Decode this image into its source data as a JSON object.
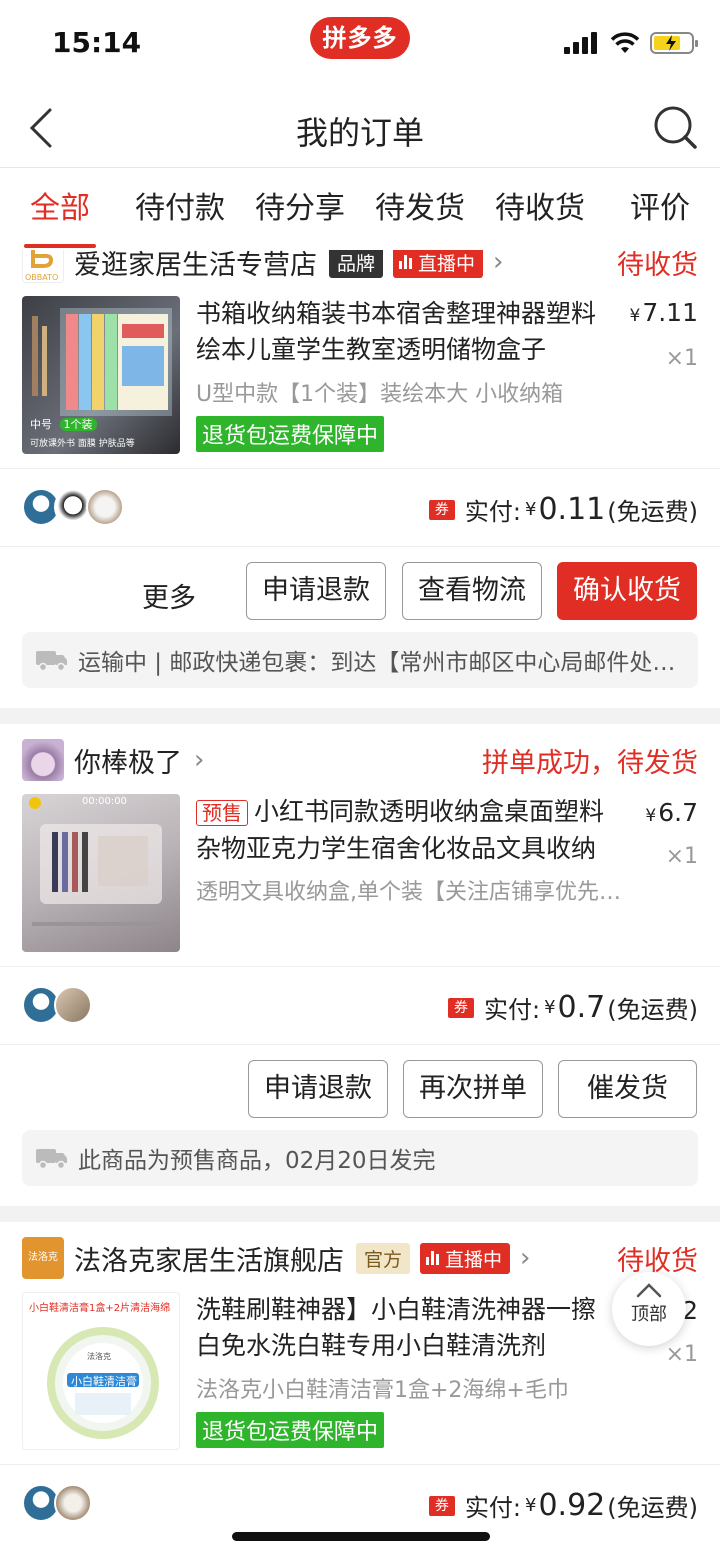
{
  "status_bar": {
    "time": "15:14",
    "app_logo": "拼多多"
  },
  "nav": {
    "title": "我的订单"
  },
  "tabs": [
    {
      "label": "全部",
      "active": true
    },
    {
      "label": "待付款"
    },
    {
      "label": "待分享"
    },
    {
      "label": "待发货"
    },
    {
      "label": "待收货"
    },
    {
      "label": "评价"
    }
  ],
  "orders": [
    {
      "shop_name": "爱逛家居生活专营店",
      "brand_badge": "品牌",
      "live_badge": "直播中",
      "status": "待收货",
      "title": "书箱收纳箱装书本宿舍整理神器塑料绘本儿童学生教室透明储物盒子",
      "price_symbol": "¥",
      "price": "7.11",
      "qty": "×1",
      "spec": "U型中款【1个装】装绘本大 小收纳箱",
      "guarantee": "退货包运费保障中",
      "thumb_label_left": "中号",
      "thumb_label_right": "1个装",
      "thumb_caption": "可放课外书 面膜 护肤品等",
      "coupon": "券",
      "paid_label": "实付:",
      "paid_symbol": "¥",
      "paid_amount": "0.11",
      "shipping_note": "(免运费)",
      "buttons": {
        "more": "更多",
        "refund": "申请退款",
        "logistics": "查看物流",
        "confirm": "确认收货"
      },
      "tracking": "运输中 | 邮政快递包裹：到达【常州市邮区中心局邮件处理中心】"
    },
    {
      "shop_name": "你棒极了",
      "status": "拼单成功，待发货",
      "presale_tag": "预售",
      "title": "小红书同款透明收纳盒桌面塑料杂物亚克力学生宿舍化妆品文具收纳",
      "price_symbol": "¥",
      "price": "6.7",
      "qty": "×1",
      "spec": "透明文具收纳盒,单个装【关注店铺享优先发货】",
      "video_time": "00:00:00",
      "coupon": "券",
      "paid_label": "实付:",
      "paid_symbol": "¥",
      "paid_amount": "0.7",
      "shipping_note": "(免运费)",
      "buttons": {
        "refund": "申请退款",
        "regroup": "再次拼单",
        "urge": "催发货"
      },
      "tracking": "此商品为预售商品，02月20日发完"
    },
    {
      "shop_name": "法洛克家居生活旗舰店",
      "shop_logo_text": "法洛克",
      "official_badge": "官方",
      "live_badge": "直播中",
      "status": "待收货",
      "title": "洗鞋刷鞋神器】小白鞋清洗神器一擦白免水洗白鞋专用小白鞋清洗剂",
      "price_tail": "2",
      "qty": "×1",
      "spec": "法洛克小白鞋清洁膏1盒+2海绵+毛巾",
      "guarantee": "退货包运费保障中",
      "thumb_top": "小白鞋清洁膏1盒+2片清洁海绵",
      "thumb_product": "小白鞋清洁膏",
      "thumb_brand": "法洛克",
      "coupon": "券",
      "paid_label": "实付:",
      "paid_symbol": "¥",
      "paid_amount": "0.92",
      "shipping_note": "(免运费)"
    }
  ],
  "float_top": {
    "label": "顶部"
  },
  "colors": {
    "accent": "#e02e24",
    "guarantee": "#2fb52c",
    "muted": "#999999"
  }
}
